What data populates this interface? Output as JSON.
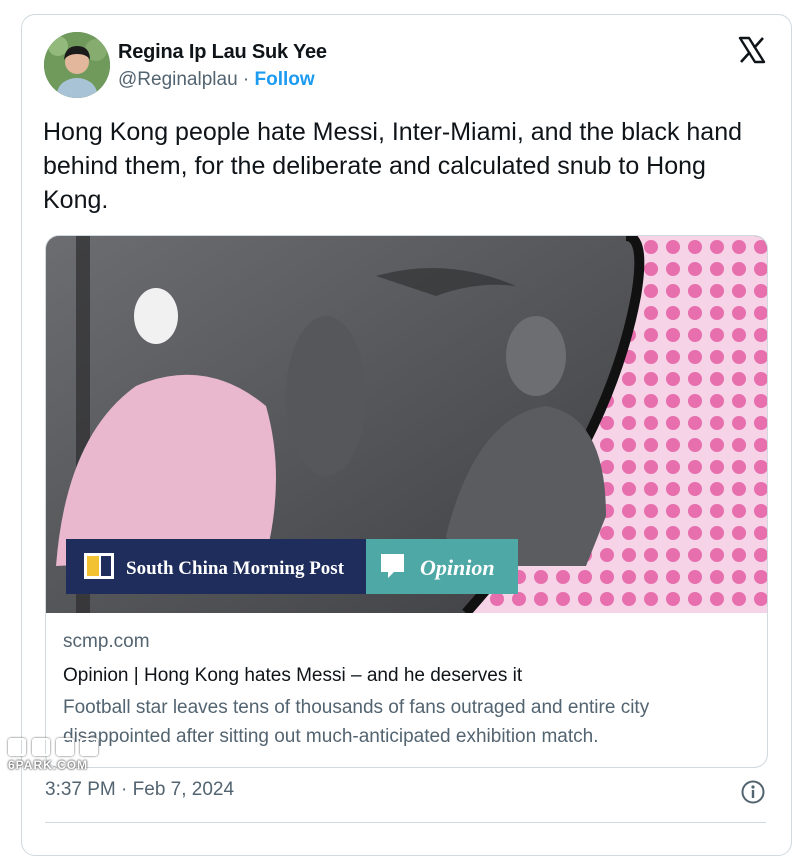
{
  "author": {
    "name": "Regina Ip Lau Suk Yee",
    "handle": "@Reginalplau",
    "separator": "·",
    "follow_label": "Follow"
  },
  "tweet": {
    "text": "Hong Kong people hate Messi, Inter-Miami, and the black hand behind them, for the deliberate and calculated snub to Hong Kong."
  },
  "link_card": {
    "media": {
      "publisher": "South China Morning Post",
      "section_label": "Opinion",
      "colors": {
        "publisher_bar": "#1f2d5c",
        "opinion_bar": "#4ea8a5",
        "pink_pattern": "#e76fae"
      }
    },
    "domain": "scmp.com",
    "title": "Opinion | Hong Kong hates Messi – and he deserves it",
    "description": "Football star leaves tens of thousands of fans outraged and entire city disappointed after sitting out much-anticipated exhibition match."
  },
  "footer": {
    "timestamp": "3:37 PM · Feb 7, 2024",
    "info_icon": "info-icon"
  },
  "icons": {
    "brand": "x-logo-icon"
  },
  "watermark": {
    "text": "6PARK.COM"
  },
  "colors": {
    "accent": "#1d9bf0",
    "text": "#0f1419",
    "muted": "#536471",
    "border": "#cfd9de"
  }
}
